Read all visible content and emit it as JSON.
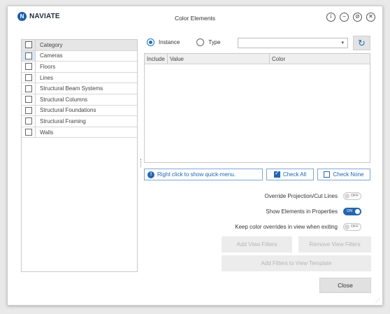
{
  "app": {
    "logo_text": "NAVIATE",
    "title": "Color Elements",
    "window_buttons": [
      {
        "name": "info-icon",
        "glyph": "i"
      },
      {
        "name": "minimize-icon",
        "glyph": "−"
      },
      {
        "name": "restore-icon",
        "glyph": "⊘"
      },
      {
        "name": "close-icon",
        "glyph": "✕"
      }
    ]
  },
  "categories": {
    "header": "Category",
    "items": [
      {
        "label": "Cameras",
        "selected": true
      },
      {
        "label": "Floors"
      },
      {
        "label": "Lines"
      },
      {
        "label": "Structural Beam Systems"
      },
      {
        "label": "Structural Columns"
      },
      {
        "label": "Structural Foundations"
      },
      {
        "label": "Structural Framing"
      },
      {
        "label": "Walls"
      }
    ]
  },
  "mode": {
    "instance_label": "Instance",
    "type_label": "Type",
    "selected": "instance"
  },
  "grid": {
    "col_include": "Include",
    "col_value": "Value",
    "col_color": "Color"
  },
  "hint": {
    "text": "Right click to show quick-menu."
  },
  "check_all_label": "Check All",
  "check_none_label": "Check None",
  "options": {
    "override": {
      "label": "Override Projection/Cut Lines",
      "state": "OFF"
    },
    "show_elements": {
      "label": "Show Elements in Properties",
      "state": "ON"
    },
    "keep_overrides": {
      "label": "Keep color overrides in view when exiting",
      "state": "OFF"
    }
  },
  "actions": {
    "add_view_filters": "Add View Filters",
    "remove_view_filters": "Remove View Filters",
    "add_filters_template": "Add Filters to View Template",
    "close": "Close"
  },
  "colors": {
    "accent": "#2466b0",
    "disabled_text": "#b5b5b5"
  }
}
